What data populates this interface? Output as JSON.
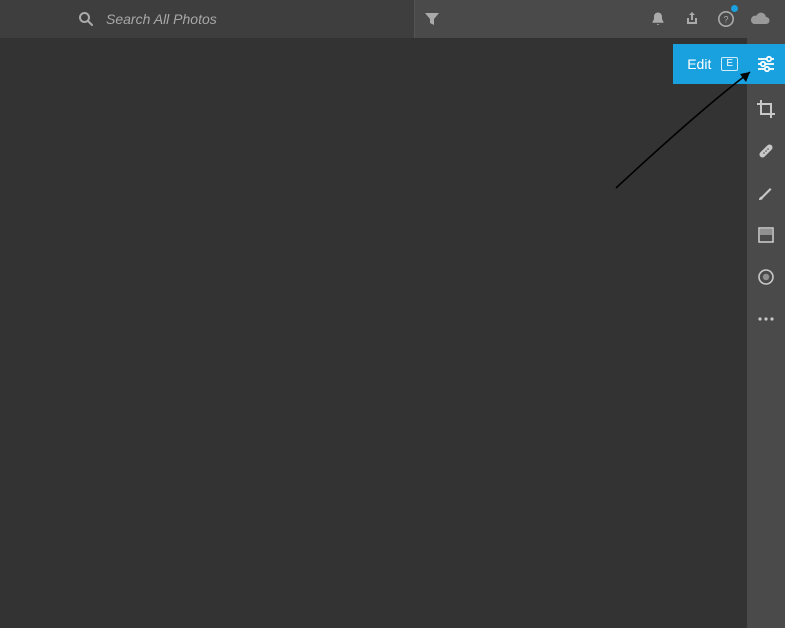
{
  "search": {
    "placeholder": "Search All Photos",
    "value": ""
  },
  "edit": {
    "label": "Edit",
    "shortcut": "E"
  },
  "colors": {
    "accent": "#19a0de",
    "canvas": "#333333",
    "chrome": "#4a4a4a"
  },
  "topIcons": [
    "notifications",
    "share",
    "help",
    "cloud"
  ],
  "rightTools": [
    "edit-sliders",
    "crop",
    "healing",
    "brush",
    "linear-gradient",
    "radial-gradient",
    "more"
  ]
}
